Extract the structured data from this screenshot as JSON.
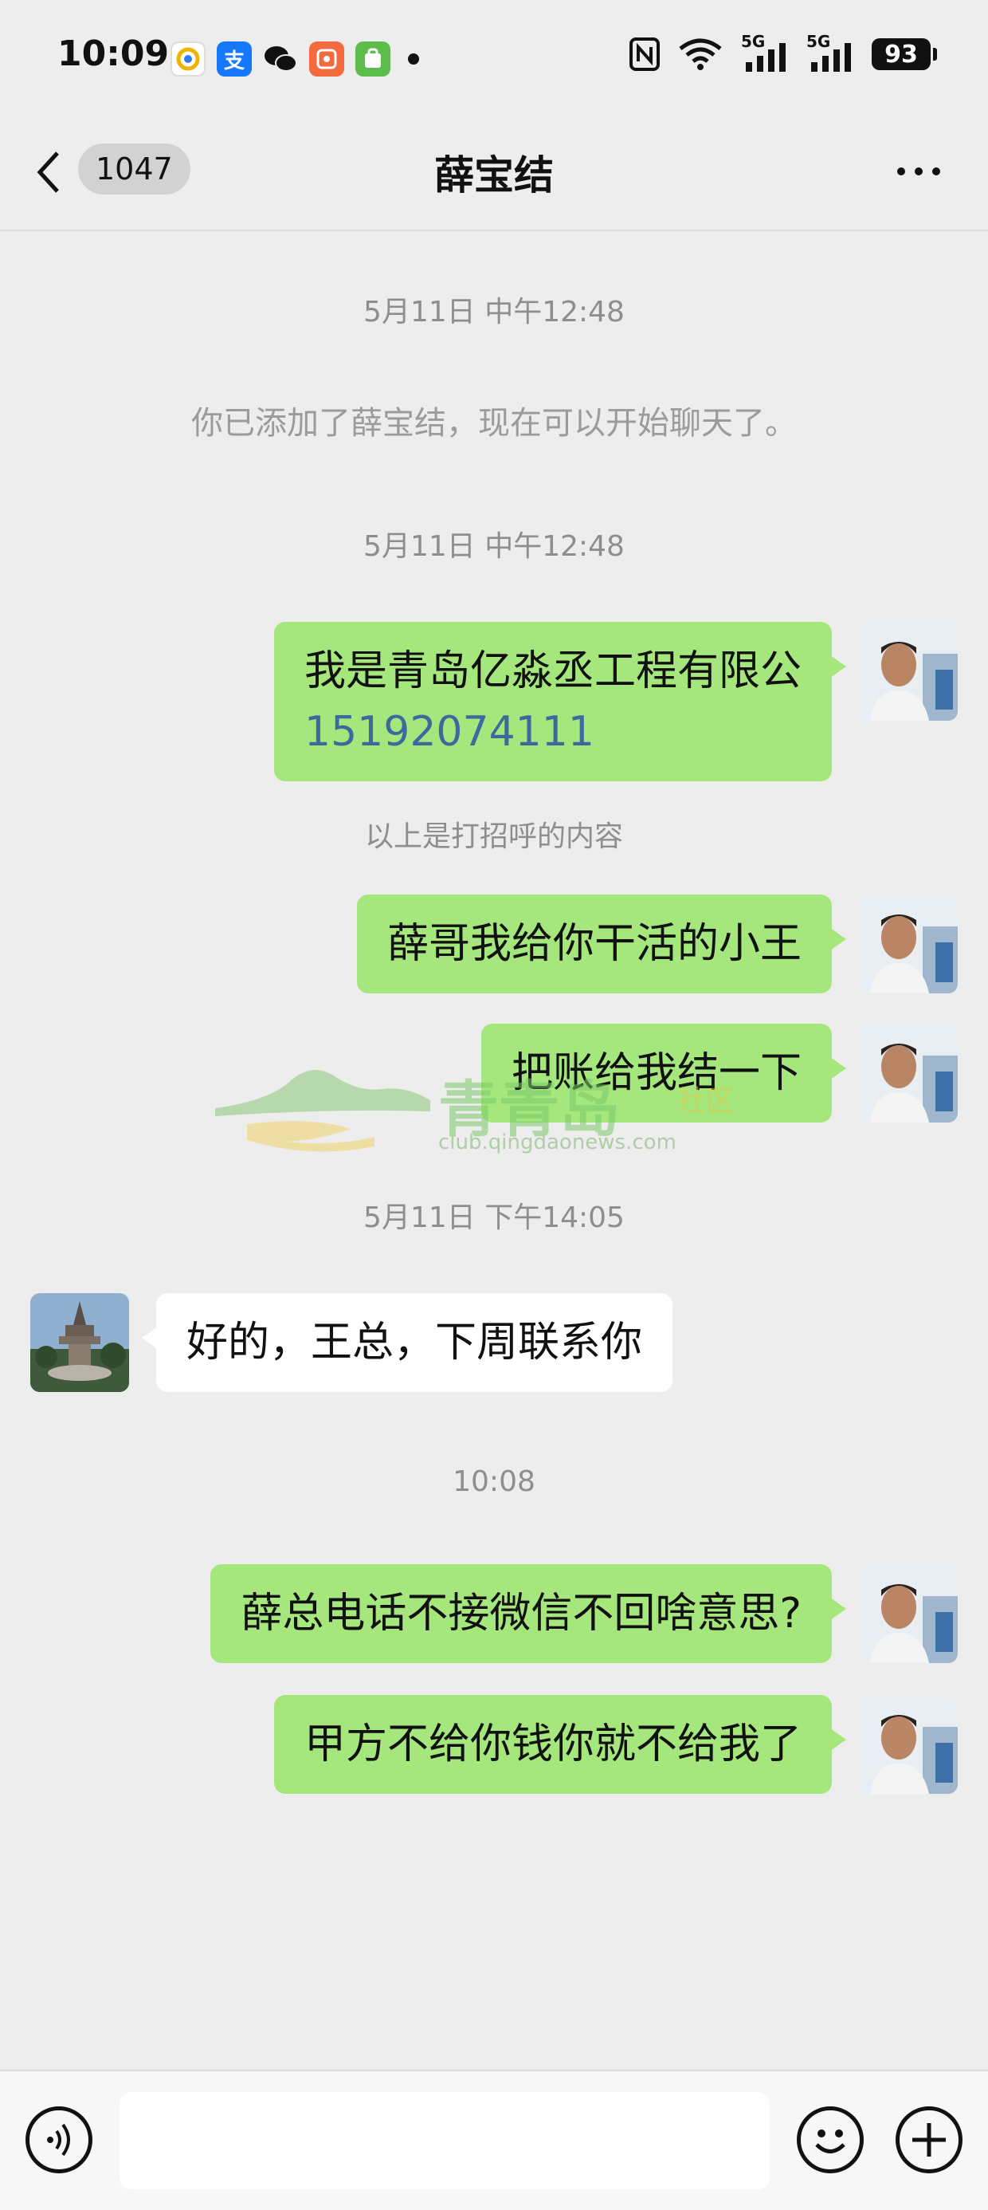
{
  "status_bar": {
    "time": "10:09",
    "notification_icons": [
      "qq-browser-icon",
      "alipay-icon",
      "wechat-icon",
      "xiaohongshu-icon",
      "app-store-icon"
    ],
    "alipay_glyph": "支",
    "network_1": "5G",
    "network_2": "5G",
    "battery": "93"
  },
  "header": {
    "back_count": "1047",
    "title": "薛宝结"
  },
  "messages": {
    "ts1": "5月11日 中午12:48",
    "system_added": "你已添加了薛宝结，现在可以开始聊天了。",
    "ts2": "5月11日 中午12:48",
    "msg1_line1": "我是青岛亿淼丞工程有限公",
    "msg1_phone": "15192074111",
    "greeting_note": "以上是打招呼的内容",
    "msg2": "薛哥我给你干活的小王",
    "msg3": "把账给我结一下",
    "ts3": "5月11日 下午14:05",
    "msg4": "好的，王总，下周联系你",
    "ts4": "10:08",
    "msg5": "薛总电话不接微信不回啥意思?",
    "msg6": "甲方不给你钱你就不给我了"
  },
  "watermark": {
    "main": "青青岛",
    "side": "社区",
    "url": "club.qingdaonews.com"
  },
  "colors": {
    "outgoing_bubble": "#a5e77c",
    "incoming_bubble": "#ffffff",
    "background": "#ededed",
    "phone_link": "#3d6a9e"
  }
}
